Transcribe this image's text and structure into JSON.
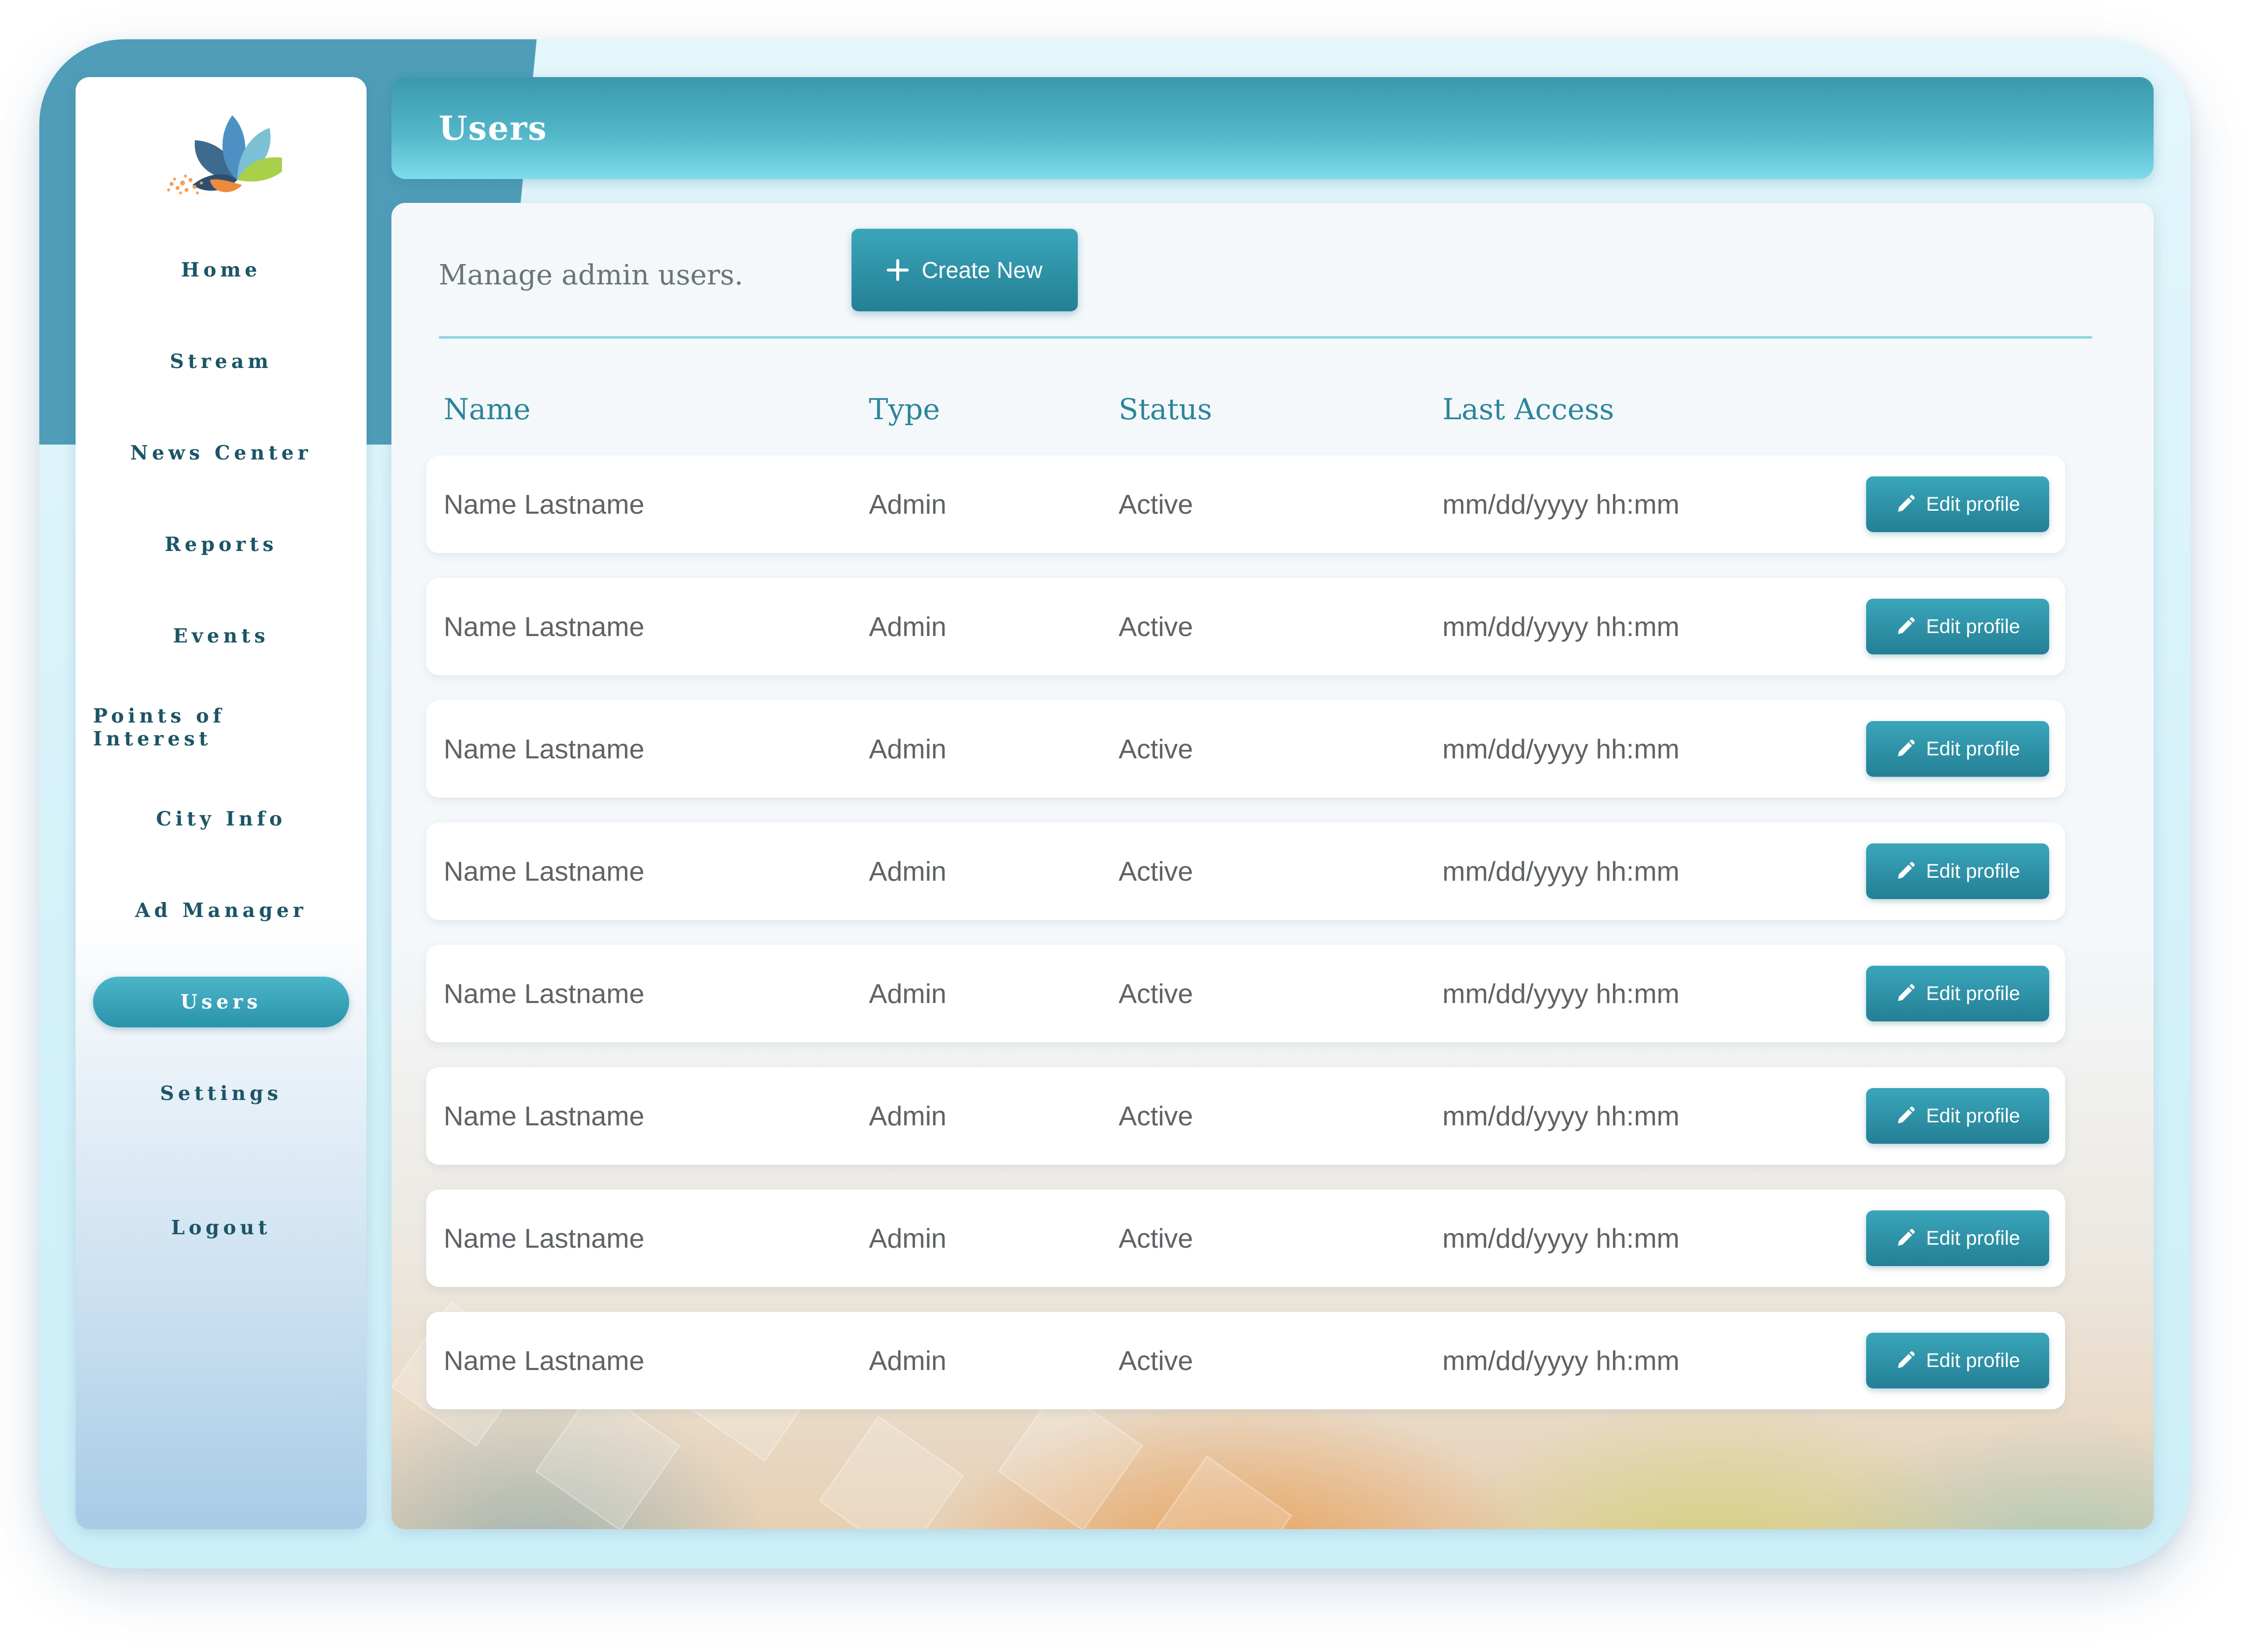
{
  "sidebar": {
    "items": [
      {
        "label": "Home"
      },
      {
        "label": "Stream"
      },
      {
        "label": "News Center"
      },
      {
        "label": "Reports"
      },
      {
        "label": "Events"
      },
      {
        "label": "Points of Interest"
      },
      {
        "label": "City Info"
      },
      {
        "label": "Ad Manager"
      },
      {
        "label": "Users",
        "active": true
      },
      {
        "label": "Settings"
      },
      {
        "label": "Logout"
      }
    ]
  },
  "header": {
    "title": "Users"
  },
  "main": {
    "subtitle": "Manage admin users.",
    "create_button": {
      "label": "Create New",
      "icon": "plus-icon"
    },
    "table": {
      "columns": [
        "Name",
        "Type",
        "Status",
        "Last Access"
      ],
      "rows": [
        {
          "name": "Name Lastname",
          "type": "Admin",
          "status": "Active",
          "last_access": "mm/dd/yyyy hh:mm",
          "action": "Edit profile"
        },
        {
          "name": "Name Lastname",
          "type": "Admin",
          "status": "Active",
          "last_access": "mm/dd/yyyy hh:mm",
          "action": "Edit profile"
        },
        {
          "name": "Name Lastname",
          "type": "Admin",
          "status": "Active",
          "last_access": "mm/dd/yyyy hh:mm",
          "action": "Edit profile"
        },
        {
          "name": "Name Lastname",
          "type": "Admin",
          "status": "Active",
          "last_access": "mm/dd/yyyy hh:mm",
          "action": "Edit profile"
        },
        {
          "name": "Name Lastname",
          "type": "Admin",
          "status": "Active",
          "last_access": "mm/dd/yyyy hh:mm",
          "action": "Edit profile"
        },
        {
          "name": "Name Lastname",
          "type": "Admin",
          "status": "Active",
          "last_access": "mm/dd/yyyy hh:mm",
          "action": "Edit profile"
        },
        {
          "name": "Name Lastname",
          "type": "Admin",
          "status": "Active",
          "last_access": "mm/dd/yyyy hh:mm",
          "action": "Edit profile"
        },
        {
          "name": "Name Lastname",
          "type": "Admin",
          "status": "Active",
          "last_access": "mm/dd/yyyy hh:mm",
          "action": "Edit profile"
        }
      ]
    }
  },
  "colors": {
    "accent": "#2a93aa",
    "header_dark": "#3b98ae",
    "header_light": "#7fdceb",
    "nav_text": "#1c5566",
    "column_header": "#2b8599",
    "cell_text": "#5f6366"
  }
}
